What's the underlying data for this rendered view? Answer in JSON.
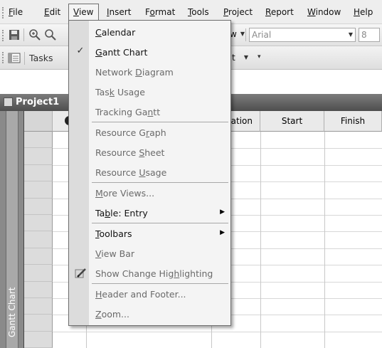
{
  "menubar": {
    "items": [
      {
        "label": "File",
        "u": "F",
        "rest": "ile"
      },
      {
        "label": "Edit",
        "u": "E",
        "rest": "dit"
      },
      {
        "label": "View",
        "u": "V",
        "rest": "iew"
      },
      {
        "label": "Insert",
        "u": "I",
        "rest": "nsert"
      },
      {
        "label": "Format",
        "pre": "F",
        "u": "o",
        "rest": "rmat"
      },
      {
        "label": "Tools",
        "u": "T",
        "rest": "ools"
      },
      {
        "label": "Project",
        "u": "P",
        "rest": "roject"
      },
      {
        "label": "Report",
        "u": "R",
        "rest": "eport"
      },
      {
        "label": "Window",
        "u": "W",
        "rest": "indow"
      },
      {
        "label": "Help",
        "u": "H",
        "rest": "elp"
      }
    ]
  },
  "toolbar1": {
    "view_combo_tail": "w",
    "font_combo": "Arial",
    "size_combo": "8"
  },
  "toolbar2": {
    "tasks_label": "Tasks",
    "combo_tail": "t"
  },
  "project": {
    "title": "Project1",
    "side_label": "Gantt Chart",
    "columns": [
      "",
      "ration",
      "Start",
      "Finish"
    ],
    "info_icon": "info-icon"
  },
  "view_menu": {
    "items": [
      {
        "label": "Calendar",
        "u": "C",
        "rest": "alendar",
        "checked": false
      },
      {
        "label": "Gantt Chart",
        "u": "G",
        "rest": "antt Chart",
        "checked": true
      },
      {
        "label": "Network Diagram",
        "pre": "Network ",
        "u": "D",
        "rest": "iagram",
        "checked": false
      },
      {
        "label": "Task Usage",
        "pre": "Tas",
        "u": "k",
        "rest": " Usage",
        "checked": false
      },
      {
        "label": "Tracking Gantt",
        "pre": "Tracking Ga",
        "u": "n",
        "rest": "tt",
        "checked": false
      },
      {
        "label": "Resource Graph",
        "pre": "Resource G",
        "u": "r",
        "rest": "aph",
        "checked": false
      },
      {
        "label": "Resource Sheet",
        "pre": "Resource ",
        "u": "S",
        "rest": "heet",
        "checked": false
      },
      {
        "label": "Resource Usage",
        "pre": "Resource ",
        "u": "U",
        "rest": "sage",
        "checked": false
      },
      {
        "label": "More Views...",
        "u": "M",
        "rest": "ore Views...",
        "checked": false
      },
      {
        "label": "Table: Entry",
        "pre": "Ta",
        "u": "b",
        "rest": "le: Entry",
        "submenu": true
      },
      {
        "label": "Toolbars",
        "u": "T",
        "rest": "oolbars",
        "submenu": true
      },
      {
        "label": "View Bar",
        "u": "V",
        "rest": "iew Bar"
      },
      {
        "label": "Show Change Highlighting",
        "pre": "Show Change Hig",
        "u": "h",
        "rest": "lighting",
        "icon": "highlight-icon"
      },
      {
        "label": "Header and Footer...",
        "u": "H",
        "rest": "eader and Footer..."
      },
      {
        "label": "Zoom...",
        "u": "Z",
        "rest": "oom..."
      }
    ]
  }
}
